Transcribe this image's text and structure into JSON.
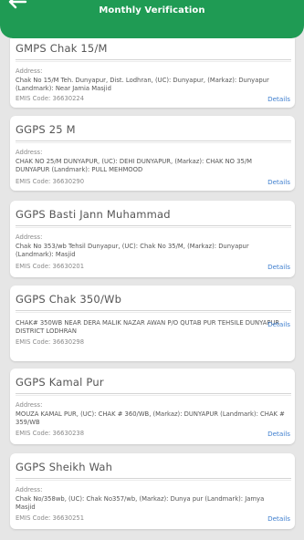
{
  "header": {
    "title": "Monthly Verification"
  },
  "colors": {
    "header_bg": "#1f9b54",
    "details_link": "#3f7fcf"
  },
  "labels": {
    "address": "Address:",
    "ems_prefix": "EMIS Code:",
    "details": "Details"
  },
  "schools": [
    {
      "name": "GMPS Chak 15/M",
      "address": "Chak No 15/M Teh. Dunyapur, Dist. Lodhran, (UC): Dunyapur, (Markaz): Dunyapur (Landmark): Near Jamia Masjid",
      "ems_code": "EMIS Code: 36630224"
    },
    {
      "name": "GGPS 25 M",
      "address": "CHAK NO 25/M DUNYAPUR, (UC): DEHI DUNYAPUR, (Markaz): CHAK NO 35/M DUNYAPUR (Landmark): PULL MEHMOOD",
      "ems_code": "EMIS Code: 36630290"
    },
    {
      "name": "GGPS Basti Jann Muhammad",
      "address": "Chak No 353/wb Tehsil Dunyapur, (UC): Chak No 35/M, (Markaz): Dunyapur (Landmark): Masjid",
      "ems_code": "EMIS Code: 36630201"
    },
    {
      "name": "GGPS Chak 350/Wb",
      "address": "CHAK# 350WB NEAR DERA MALIK NAZAR AWAN P/O QUTAB PUR TEHSILE DUNYAPUR DISTRICT LODHRAN",
      "ems_code": "EMIS Code: 36630298"
    },
    {
      "name": "GGPS Kamal Pur",
      "address": "MOUZA KAMAL PUR, (UC): CHAK # 360/WB, (Markaz): DUNYAPUR (Landmark): CHAK # 359/WB",
      "ems_code": "EMIS Code: 36630238"
    },
    {
      "name": "GGPS Sheikh Wah",
      "address": "Chak No/358wb, (UC): Chak No357/wb, (Markaz): Dunya pur (Landmark): Jamya Masjid",
      "ems_code": "EMIS Code: 36630251"
    }
  ]
}
